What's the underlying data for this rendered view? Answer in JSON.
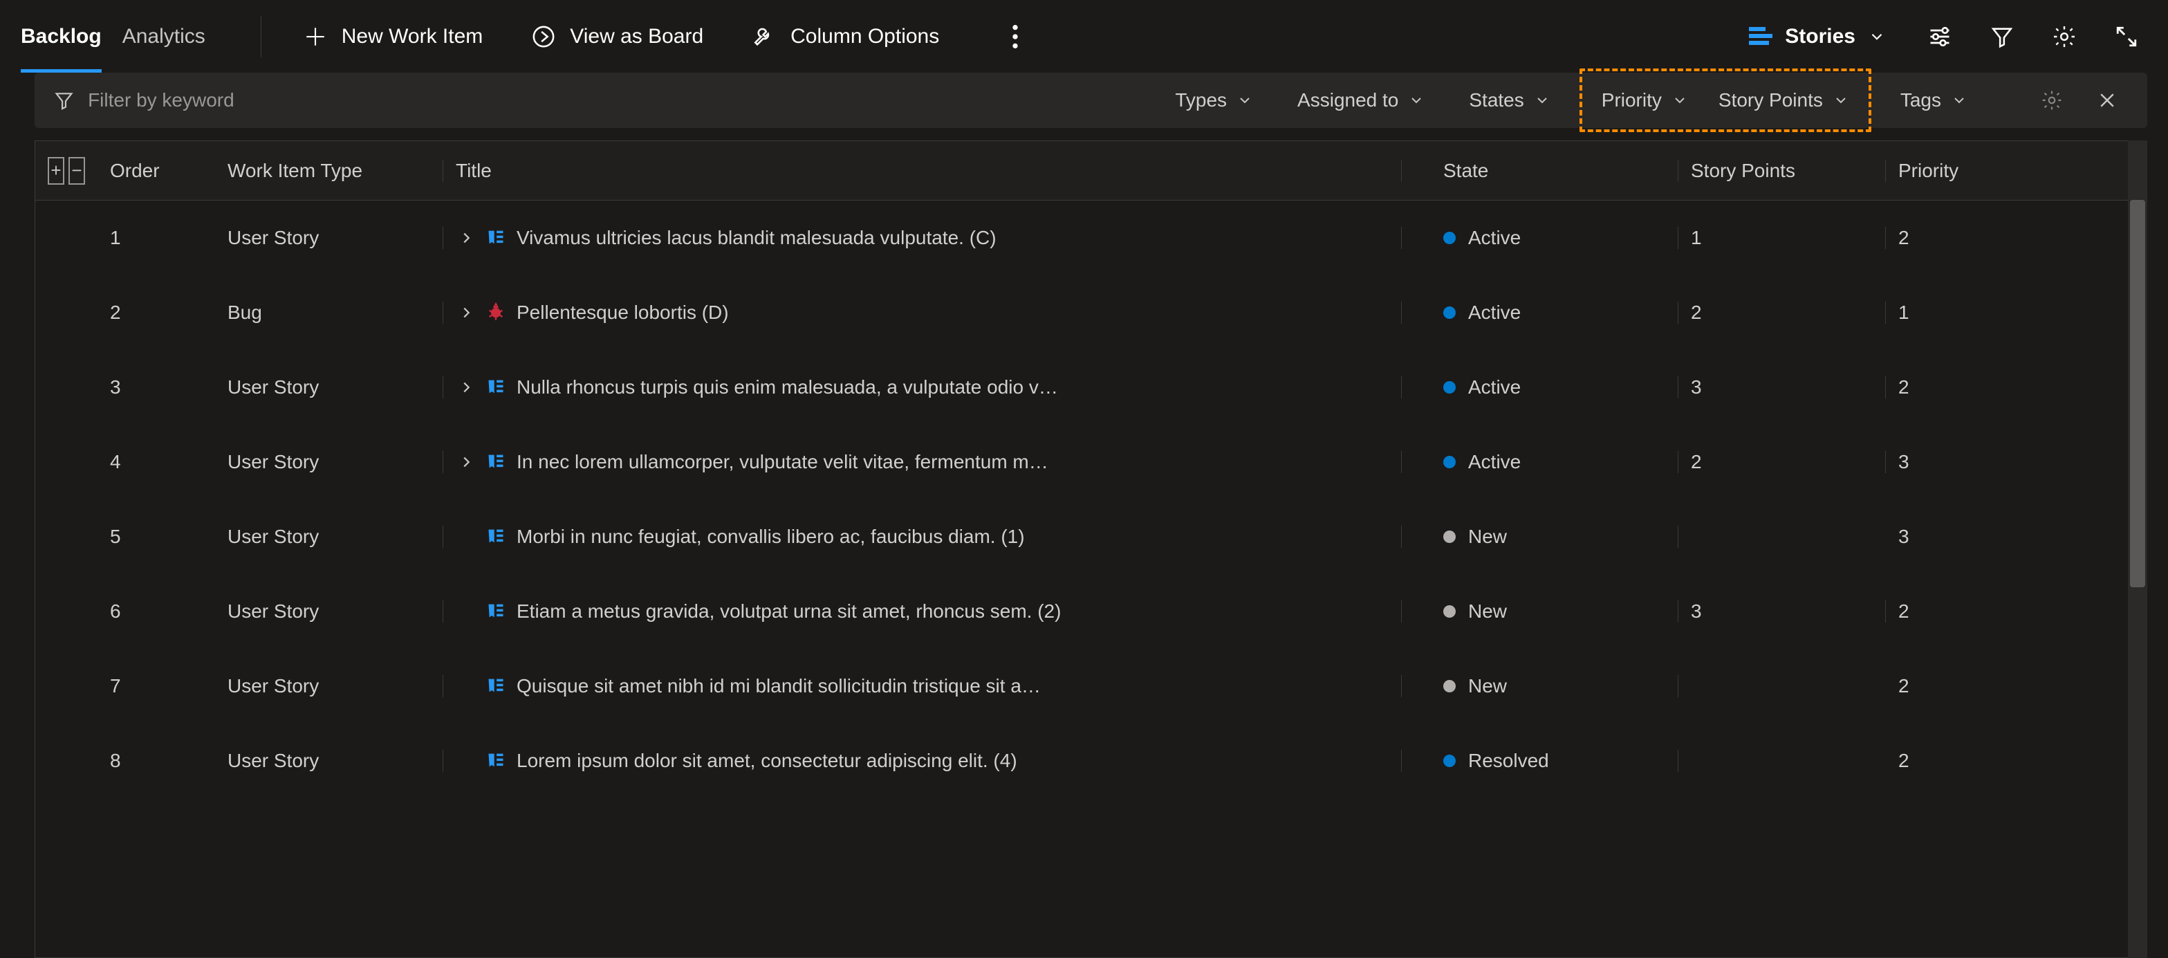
{
  "tabs": {
    "backlog": "Backlog",
    "analytics": "Analytics"
  },
  "toolbar": {
    "new_item": "New Work Item",
    "view_board": "View as Board",
    "column_options": "Column Options",
    "level": "Stories"
  },
  "filter": {
    "placeholder": "Filter by keyword",
    "chips": {
      "types": "Types",
      "assigned": "Assigned to",
      "states": "States",
      "priority": "Priority",
      "story_points": "Story Points",
      "tags": "Tags"
    }
  },
  "columns": {
    "order": "Order",
    "type": "Work Item Type",
    "title": "Title",
    "state": "State",
    "story_points": "Story Points",
    "priority": "Priority"
  },
  "state_colors": {
    "Active": "#007acc",
    "New": "#b3b0ad",
    "Resolved": "#007acc"
  },
  "rows": [
    {
      "order": "1",
      "type": "User Story",
      "kind": "story",
      "expandable": true,
      "title": "Vivamus ultricies lacus blandit malesuada vulputate. (C)",
      "state": "Active",
      "sp": "1",
      "pri": "2"
    },
    {
      "order": "2",
      "type": "Bug",
      "kind": "bug",
      "expandable": true,
      "title": "Pellentesque lobortis (D)",
      "state": "Active",
      "sp": "2",
      "pri": "1"
    },
    {
      "order": "3",
      "type": "User Story",
      "kind": "story",
      "expandable": true,
      "title": "Nulla rhoncus turpis quis enim malesuada, a vulputate odio v…",
      "state": "Active",
      "sp": "3",
      "pri": "2"
    },
    {
      "order": "4",
      "type": "User Story",
      "kind": "story",
      "expandable": true,
      "title": "In nec lorem ullamcorper, vulputate velit vitae, fermentum m…",
      "state": "Active",
      "sp": "2",
      "pri": "3"
    },
    {
      "order": "5",
      "type": "User Story",
      "kind": "story",
      "expandable": false,
      "title": "Morbi in nunc feugiat, convallis libero ac, faucibus diam. (1)",
      "state": "New",
      "sp": "",
      "pri": "3"
    },
    {
      "order": "6",
      "type": "User Story",
      "kind": "story",
      "expandable": false,
      "title": "Etiam a metus gravida, volutpat urna sit amet, rhoncus sem. (2)",
      "state": "New",
      "sp": "3",
      "pri": "2"
    },
    {
      "order": "7",
      "type": "User Story",
      "kind": "story",
      "expandable": false,
      "title": "Quisque sit amet nibh id mi blandit sollicitudin tristique sit a…",
      "state": "New",
      "sp": "",
      "pri": "2"
    },
    {
      "order": "8",
      "type": "User Story",
      "kind": "story",
      "expandable": false,
      "title": "Lorem ipsum dolor sit amet, consectetur adipiscing elit. (4)",
      "state": "Resolved",
      "sp": "",
      "pri": "2"
    }
  ]
}
